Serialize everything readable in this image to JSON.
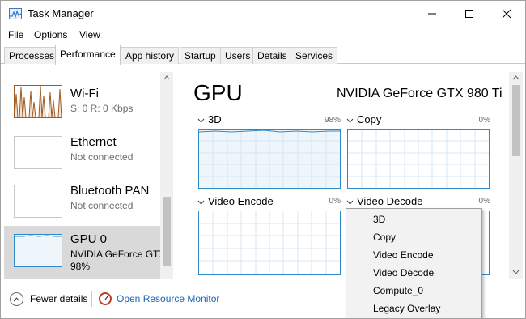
{
  "window": {
    "title": "Task Manager"
  },
  "menu": [
    "File",
    "Options",
    "View"
  ],
  "tabs": [
    "Processes",
    "Performance",
    "App history",
    "Startup",
    "Users",
    "Details",
    "Services"
  ],
  "active_tab": "Performance",
  "resources": [
    {
      "name": "Wi-Fi",
      "sub": "S: 0  R: 0 Kbps"
    },
    {
      "name": "Ethernet",
      "sub": "Not connected"
    },
    {
      "name": "Bluetooth PAN",
      "sub": "Not connected"
    },
    {
      "name": "GPU 0",
      "sub": "NVIDIA GeForce GTX",
      "sub2": "98%"
    }
  ],
  "detail": {
    "title": "GPU",
    "model": "NVIDIA GeForce GTX 980 Ti",
    "graphs": [
      {
        "label": "3D",
        "pct": "98%"
      },
      {
        "label": "Copy",
        "pct": "0%"
      },
      {
        "label": "Video Encode",
        "pct": "0%"
      },
      {
        "label": "Video Decode",
        "pct": "0%"
      }
    ]
  },
  "dropdown": {
    "items": [
      "3D",
      "Copy",
      "Video Encode",
      "Video Decode",
      "Compute_0",
      "Legacy Overlay"
    ]
  },
  "footer": {
    "fewer_details": "Fewer details",
    "open_resource_monitor": "Open Resource Monitor"
  },
  "colors": {
    "accent_blue": "#2d8ac7",
    "wifi_orange": "#a35a1f",
    "link_blue": "#1a66b3"
  }
}
